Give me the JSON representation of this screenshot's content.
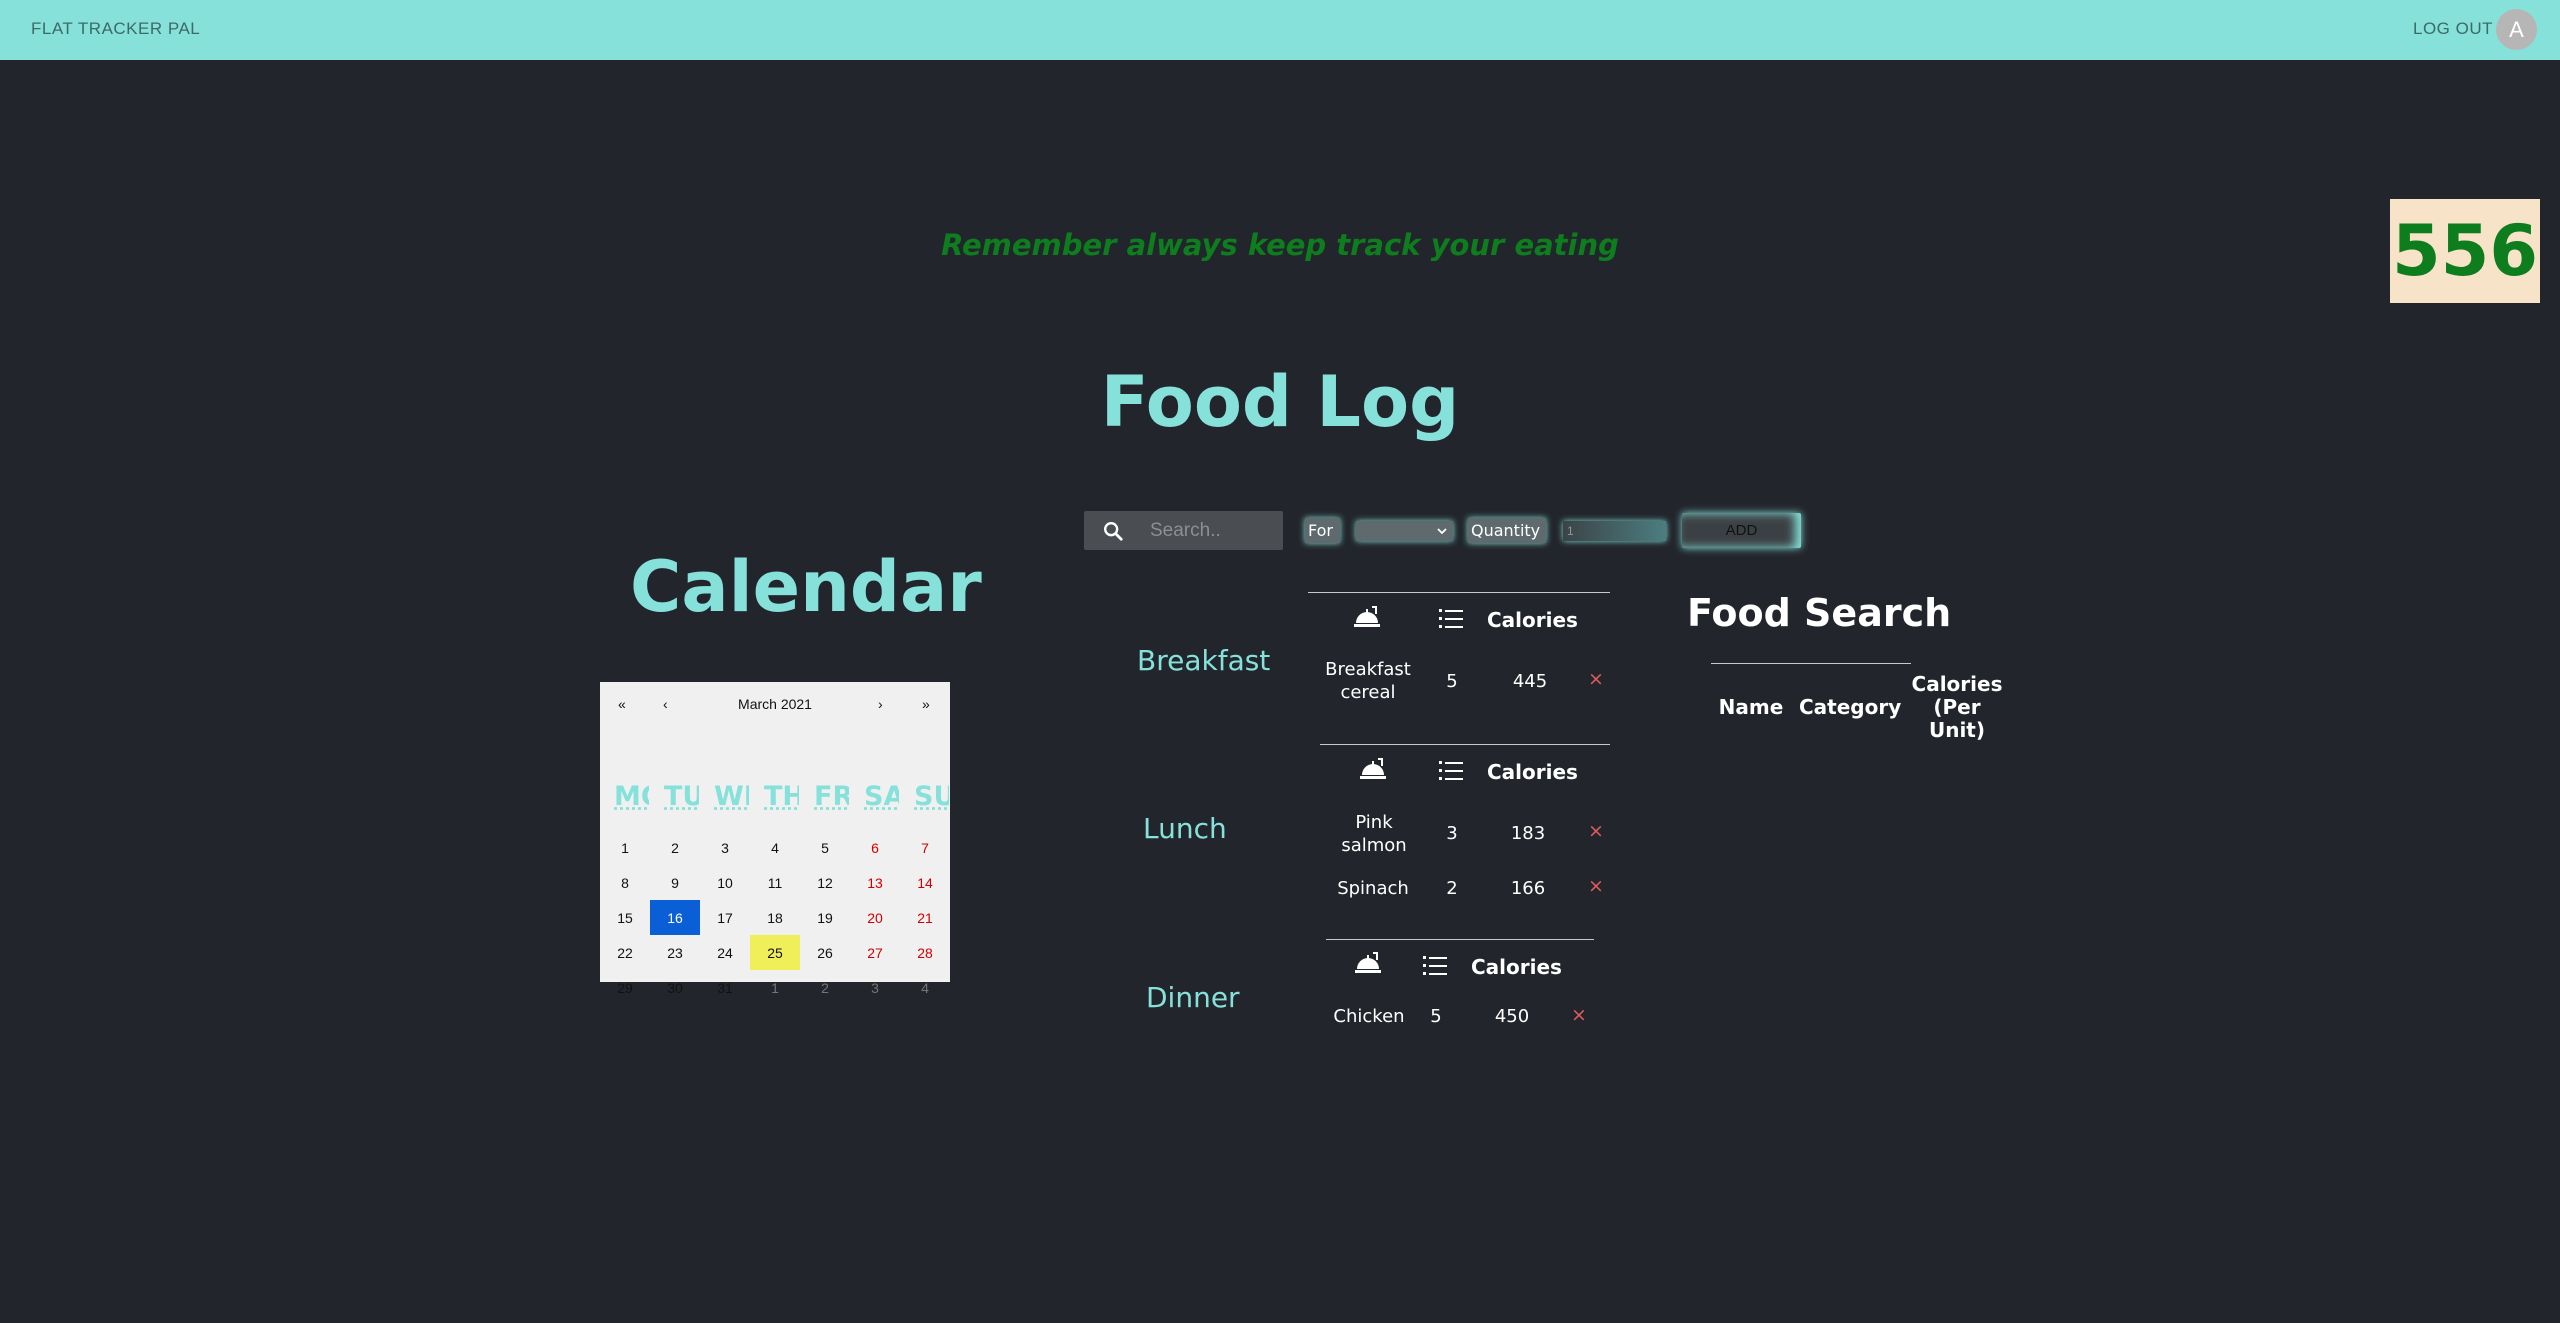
{
  "app": {
    "brand": "FLAT TRACKER PAL",
    "logout_label": "LOG OUT",
    "avatar_initial": "A",
    "accent": "#86e1db",
    "background": "#22262c"
  },
  "header": {
    "reminder": "Remember always keep track your eating",
    "calorie_total": "556",
    "title": "Food Log"
  },
  "add_bar": {
    "search_placeholder": "Search..",
    "for_label": "For",
    "for_selected": "",
    "quantity_label": "Quantity",
    "quantity_value": "1",
    "add_label": "ADD"
  },
  "calendar": {
    "title": "Calendar",
    "month": "March 2021",
    "nav": {
      "prev_year": "«",
      "prev_month": "‹",
      "next_month": "›",
      "next_year": "»"
    },
    "weekdays": [
      "MO",
      "TU",
      "WE",
      "TH",
      "FR",
      "SA",
      "SU"
    ],
    "weeks": [
      [
        "1",
        "2",
        "3",
        "4",
        "5",
        "6",
        "7"
      ],
      [
        "8",
        "9",
        "10",
        "11",
        "12",
        "13",
        "14"
      ],
      [
        "15",
        "16",
        "17",
        "18",
        "19",
        "20",
        "21"
      ],
      [
        "22",
        "23",
        "24",
        "25",
        "26",
        "27",
        "28"
      ],
      [
        "29",
        "30",
        "31",
        "1",
        "2",
        "3",
        "4"
      ]
    ],
    "selected_day": "16",
    "today_day": "25"
  },
  "meals": {
    "calories_header": "Calories",
    "breakfast": {
      "label": "Breakfast",
      "rows": [
        {
          "name": "Breakfast cereal",
          "qty": "5",
          "calories": "445",
          "delete": "×"
        }
      ]
    },
    "lunch": {
      "label": "Lunch",
      "rows": [
        {
          "name": "Pink salmon",
          "qty": "3",
          "calories": "183",
          "delete": "×"
        },
        {
          "name": "Spinach",
          "qty": "2",
          "calories": "166",
          "delete": "×"
        }
      ]
    },
    "dinner": {
      "label": "Dinner",
      "rows": [
        {
          "name": "Chicken",
          "qty": "5",
          "calories": "450",
          "delete": "×"
        }
      ]
    }
  },
  "food_search": {
    "title": "Food Search",
    "headers": {
      "name": "Name",
      "category": "Category",
      "calories": "Calories (Per Unit)"
    }
  }
}
